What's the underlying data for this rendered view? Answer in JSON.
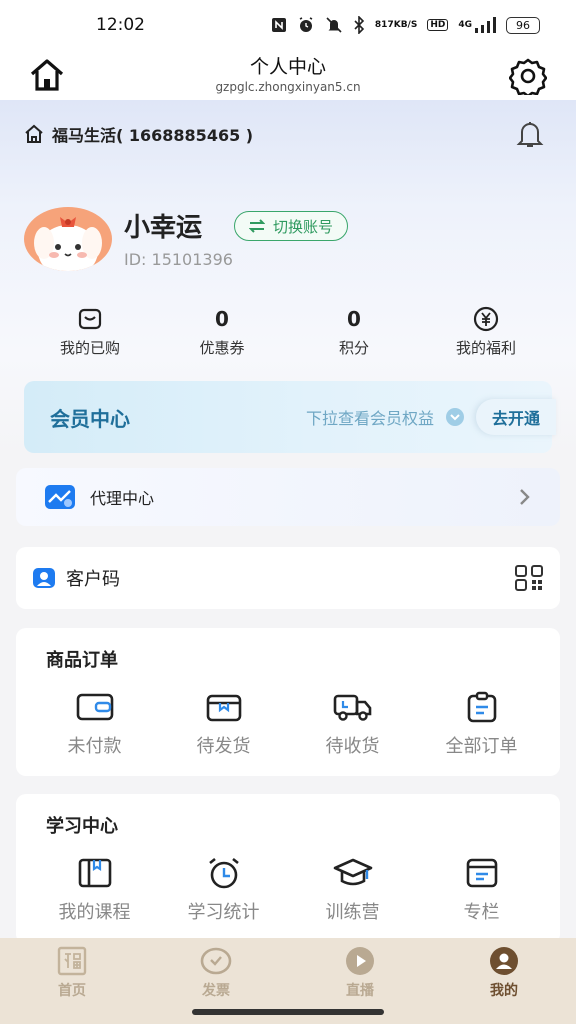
{
  "status_bar": {
    "time": "12:02",
    "net_speed_value": "817",
    "net_speed_unit": "KB/S",
    "hd": "HD",
    "signal": "4G",
    "battery": "96"
  },
  "nav": {
    "title": "个人中心",
    "url": "gzpglc.zhongxinyan5.cn",
    "home_icon": "home-icon",
    "settings_icon": "gear-icon"
  },
  "shop": {
    "name": "福马生活( 1668885465 )"
  },
  "user": {
    "name": "小幸运",
    "switch_label": "切换账号",
    "id": "ID: 15101396"
  },
  "stats": [
    {
      "label": "我的已购",
      "icon": "purchase-icon"
    },
    {
      "label": "优惠券",
      "value": "0"
    },
    {
      "label": "积分",
      "value": "0"
    },
    {
      "label": "我的福利",
      "icon": "yen-icon"
    }
  ],
  "member": {
    "title": "会员中心",
    "hint": "下拉查看会员权益",
    "cta": "去开通"
  },
  "agent": {
    "label": "代理中心"
  },
  "client": {
    "label": "客户码"
  },
  "orders": {
    "title": "商品订单",
    "items": [
      {
        "label": "未付款",
        "icon": "wallet-icon"
      },
      {
        "label": "待发货",
        "icon": "box-icon"
      },
      {
        "label": "待收货",
        "icon": "truck-icon"
      },
      {
        "label": "全部订单",
        "icon": "clipboard-icon"
      }
    ]
  },
  "study": {
    "title": "学习中心",
    "items": [
      {
        "label": "我的课程",
        "icon": "book-icon"
      },
      {
        "label": "学习统计",
        "icon": "alarm-clock-icon"
      },
      {
        "label": "训练营",
        "icon": "graduation-cap-icon"
      },
      {
        "label": "专栏",
        "icon": "column-icon"
      }
    ]
  },
  "tabbar": {
    "items": [
      {
        "label": "首页",
        "icon": "fu-icon"
      },
      {
        "label": "发票",
        "icon": "invoice-icon"
      },
      {
        "label": "直播",
        "icon": "play-icon"
      },
      {
        "label": "我的",
        "icon": "user-icon"
      }
    ],
    "active_index": 3
  },
  "colors": {
    "accent_green": "#3aa66b",
    "member_blue": "#1f6f9a",
    "tabbar_bg": "#ece3d6",
    "tab_active": "#6e4f30"
  }
}
